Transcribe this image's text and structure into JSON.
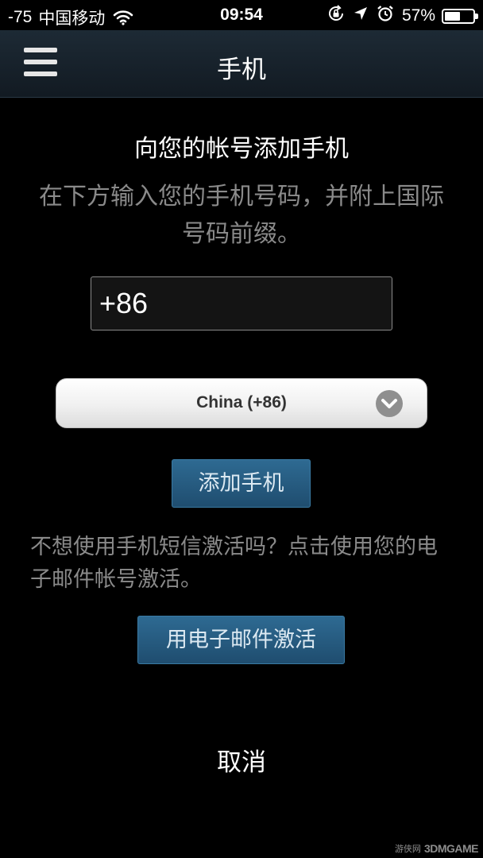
{
  "status_bar": {
    "signal": "-75",
    "carrier": "中国移动",
    "time": "09:54",
    "battery": "57%",
    "battery_level": 0.57,
    "icons": [
      "wifi-icon",
      "rotation-lock-icon",
      "location-arrow-icon",
      "alarm-icon",
      "battery-icon"
    ]
  },
  "header": {
    "title": "手机",
    "menu_icon": "hamburger-menu-icon",
    "background": "#17222c"
  },
  "content": {
    "heading": "向您的帐号添加手机",
    "instruction": "在下方输入您的手机号码，并附上国际号码前缀。",
    "phone_value": "+86",
    "country_selected": "China (+86)",
    "add_button": "添加手机",
    "alt_text": "不想使用手机短信激活吗？点击使用您的电子邮件帐号激活。",
    "email_button": "用电子邮件激活",
    "cancel": "取消"
  },
  "watermark": {
    "cn": "游侠网",
    "en": "3DMGAME"
  },
  "colors": {
    "button_blue": "#2a5f84",
    "muted_text": "#8a8a8a",
    "background": "#000000"
  }
}
